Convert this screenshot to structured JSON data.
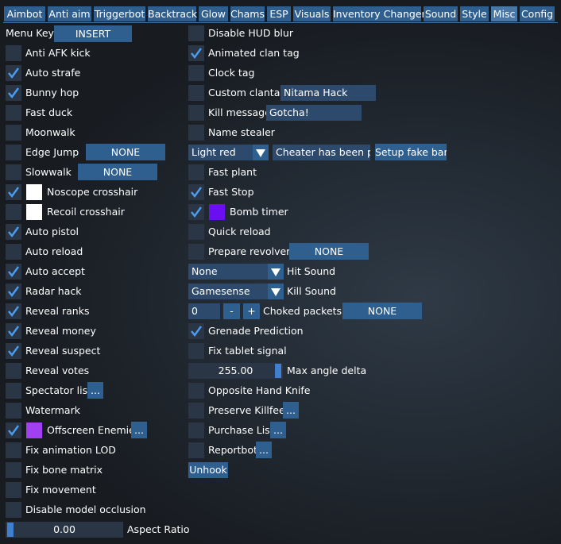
{
  "tabs": [
    {
      "label": "Aimbot"
    },
    {
      "label": "Anti aim"
    },
    {
      "label": "Triggerbot"
    },
    {
      "label": "Backtrack"
    },
    {
      "label": "Glow"
    },
    {
      "label": "Chams"
    },
    {
      "label": "ESP"
    },
    {
      "label": "Visuals"
    },
    {
      "label": "Inventory Changer"
    },
    {
      "label": "Sound"
    },
    {
      "label": "Style"
    },
    {
      "label": "Misc",
      "active": true
    },
    {
      "label": "Config"
    }
  ],
  "left": {
    "menu_key": {
      "label": "Menu Key",
      "value": "INSERT"
    },
    "anti_afk": {
      "label": "Anti AFK kick",
      "checked": false
    },
    "auto_strafe": {
      "label": "Auto strafe",
      "checked": true
    },
    "bunny_hop": {
      "label": "Bunny hop",
      "checked": true
    },
    "fast_duck": {
      "label": "Fast duck",
      "checked": false
    },
    "moonwalk": {
      "label": "Moonwalk",
      "checked": false
    },
    "edge_jump": {
      "label": "Edge Jump",
      "checked": false,
      "key": "NONE"
    },
    "slowwalk": {
      "label": "Slowwalk",
      "checked": false,
      "key": "NONE"
    },
    "noscope_crosshair": {
      "label": "Noscope crosshair",
      "checked": true,
      "color": "#ffffff"
    },
    "recoil_crosshair": {
      "label": "Recoil crosshair",
      "checked": false,
      "color": "#ffffff"
    },
    "auto_pistol": {
      "label": "Auto pistol",
      "checked": true
    },
    "auto_reload": {
      "label": "Auto reload",
      "checked": false
    },
    "auto_accept": {
      "label": "Auto accept",
      "checked": true
    },
    "radar_hack": {
      "label": "Radar hack",
      "checked": true
    },
    "reveal_ranks": {
      "label": "Reveal ranks",
      "checked": true
    },
    "reveal_money": {
      "label": "Reveal money",
      "checked": true
    },
    "reveal_suspect": {
      "label": "Reveal suspect",
      "checked": true
    },
    "reveal_votes": {
      "label": "Reveal votes",
      "checked": false
    },
    "spectator_list": {
      "label": "Spectator list",
      "checked": false,
      "more": "..."
    },
    "watermark": {
      "label": "Watermark",
      "checked": false
    },
    "offscreen_enemies": {
      "label": "Offscreen Enemies",
      "checked": true,
      "color": "#a040f0",
      "more": "..."
    },
    "fix_anim_lod": {
      "label": "Fix animation LOD",
      "checked": false
    },
    "fix_bone_matrix": {
      "label": "Fix bone matrix",
      "checked": false
    },
    "fix_movement": {
      "label": "Fix movement",
      "checked": false
    },
    "disable_model_occlusion": {
      "label": "Disable model occlusion",
      "checked": false
    },
    "aspect_ratio": {
      "label": "Aspect Ratio",
      "value": "0.00",
      "fraction": 0.0
    }
  },
  "right": {
    "disable_hud_blur": {
      "label": "Disable HUD blur",
      "checked": false
    },
    "animated_clan_tag": {
      "label": "Animated clan tag",
      "checked": true
    },
    "clock_tag": {
      "label": "Clock tag",
      "checked": false
    },
    "custom_clantag": {
      "label": "Custom clantag",
      "checked": false,
      "value": "Nitama Hack"
    },
    "kill_message": {
      "label": "Kill message",
      "checked": false,
      "value": "Gotcha!"
    },
    "name_stealer": {
      "label": "Name stealer",
      "checked": false
    },
    "fake_ban": {
      "color_option": "Light red",
      "message": "Cheater has been permanently banned",
      "button": "Setup fake ban"
    },
    "fast_plant": {
      "label": "Fast plant",
      "checked": false
    },
    "fast_stop": {
      "label": "Fast Stop",
      "checked": true
    },
    "bomb_timer": {
      "label": "Bomb timer",
      "checked": true,
      "color": "#6a10f0"
    },
    "quick_reload": {
      "label": "Quick reload",
      "checked": false
    },
    "prepare_revolver": {
      "label": "Prepare revolver",
      "checked": false,
      "key": "NONE"
    },
    "hit_sound": {
      "label": "Hit Sound",
      "value": "None"
    },
    "kill_sound": {
      "label": "Kill Sound",
      "value": "Gamesense"
    },
    "choked_packets": {
      "label": "Choked packets",
      "value": "0",
      "minus": "-",
      "plus": "+",
      "key": "NONE"
    },
    "grenade_prediction": {
      "label": "Grenade Prediction",
      "checked": true
    },
    "fix_tablet_signal": {
      "label": "Fix tablet signal",
      "checked": false
    },
    "max_angle_delta": {
      "label": "Max angle delta",
      "value": "255.00",
      "fraction": 1.0
    },
    "opposite_hand_knife": {
      "label": "Opposite Hand Knife",
      "checked": false
    },
    "preserve_killfeed": {
      "label": "Preserve Killfeed",
      "checked": false,
      "more": "..."
    },
    "purchase_list": {
      "label": "Purchase List",
      "checked": false,
      "more": "..."
    },
    "reportbot": {
      "label": "Reportbot",
      "checked": false,
      "more": "..."
    },
    "unhook": {
      "label": "Unhook"
    }
  },
  "icons": {
    "check": "checkmark-icon",
    "dropdown": "triangle-down-icon"
  }
}
